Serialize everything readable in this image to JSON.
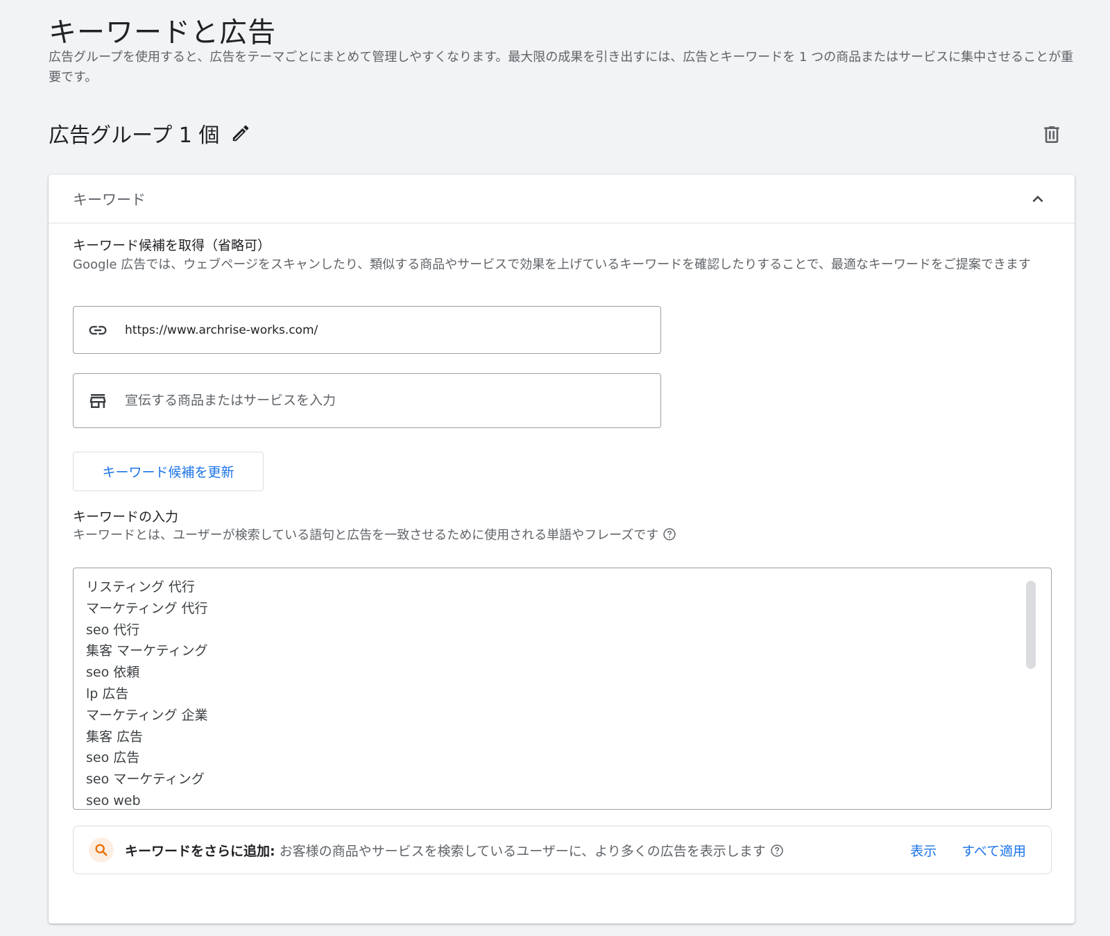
{
  "header": {
    "title": "キーワードと広告",
    "description": "広告グループを使用すると、広告をテーマごとにまとめて管理しやすくなります。最大限の成果を引き出すには、広告とキーワードを 1 つの商品またはサービスに集中させることが重要です。"
  },
  "ad_group": {
    "title": "広告グループ 1 個",
    "edit_icon": "pencil-icon",
    "delete_icon": "trash-icon"
  },
  "keywords_card": {
    "header_title": "キーワード",
    "collapse_icon": "chevron-up-icon",
    "suggest": {
      "label": "キーワード候補を取得（省略可）",
      "description": "Google 広告では、ウェブページをスキャンしたり、類似する商品やサービスで効果を上げているキーワードを確認したりすることで、最適なキーワードをご提案できます",
      "url_field": {
        "icon": "link-icon",
        "value": "https://www.archrise-works.com/"
      },
      "product_field": {
        "icon": "storefront-icon",
        "placeholder": "宣伝する商品またはサービスを入力"
      },
      "refresh_button": "キーワード候補を更新"
    },
    "entry": {
      "label": "キーワードの入力",
      "description": "キーワードとは、ユーザーが検索している語句と広告を一致させるために使用される単語やフレーズです",
      "help_icon": "help-circle-icon",
      "keywords": [
        "リスティング 代行",
        "マーケティング 代行",
        "seo 代行",
        "集客 マーケティング",
        "seo 依頼",
        "lp 広告",
        "マーケティング 企業",
        "集客 広告",
        "seo 広告",
        "seo マーケティング",
        "seo web"
      ]
    },
    "more_keywords": {
      "icon": "search-icon",
      "title": "キーワードをさらに追加:",
      "text": "お客様の商品やサービスを検索しているユーザーに、より多くの広告を表示します",
      "view_link": "表示",
      "apply_all_link": "すべて適用"
    }
  },
  "colors": {
    "background": "#f1f3f4",
    "link": "#1a73e8",
    "accent_orange": "#e8710a"
  }
}
